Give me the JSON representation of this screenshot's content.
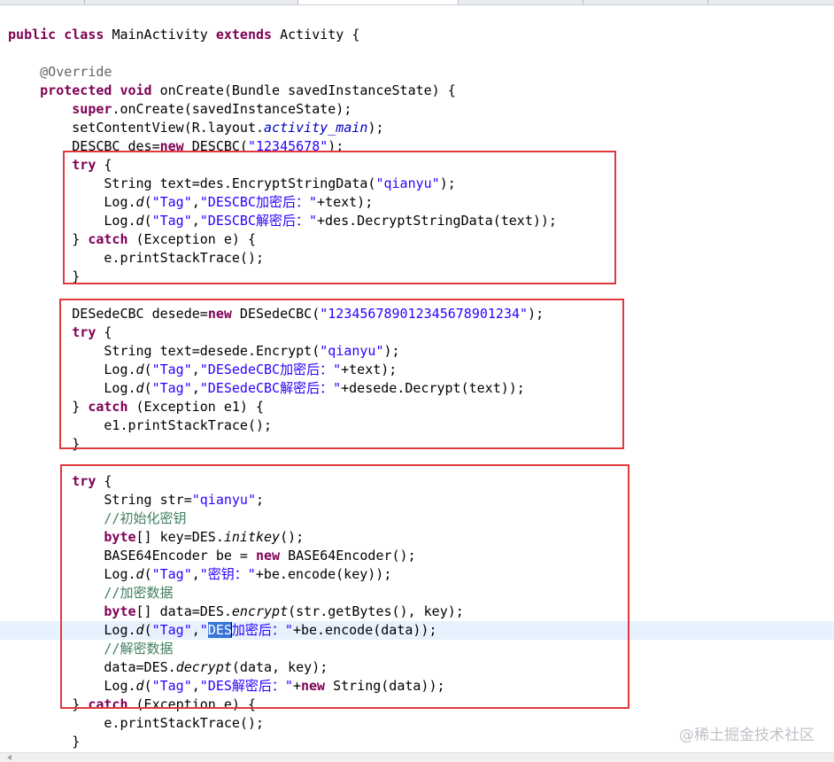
{
  "watermark": "@稀土掘金技术社区",
  "code": {
    "class_decl": {
      "kw1": "public",
      "kw2": "class",
      "name": "MainActivity",
      "kw3": "extends",
      "base": "Activity {"
    },
    "override": "@Override",
    "oncreate": {
      "kw1": "protected",
      "kw2": "void",
      "sig": "onCreate(Bundle savedInstanceState) {"
    },
    "super_call": {
      "kw": "super",
      "rest": ".onCreate(savedInstanceState);"
    },
    "set_content": {
      "pre": "setContentView(R.layout.",
      "field": "activity_main",
      "post": ");"
    },
    "descbc_decl": {
      "pre": "DESCBC des=",
      "kw": "new",
      "mid": " DESCBC(",
      "str": "\"12345678\"",
      "post": ");"
    },
    "block1": {
      "try": "try",
      "l1": {
        "pre": "String text=des.EncryptStringData(",
        "str": "\"qianyu\"",
        "post": ");"
      },
      "l2": {
        "pre": "Log.",
        "fn": "d",
        "p1": "(",
        "s1": "\"Tag\"",
        "c": ",",
        "s2": "\"DESCBC加密后：\"",
        "post": "+text);"
      },
      "l3": {
        "pre": "Log.",
        "fn": "d",
        "p1": "(",
        "s1": "\"Tag\"",
        "c": ",",
        "s2": "\"DESCBC解密后：\"",
        "post": "+des.DecryptStringData(text));"
      },
      "catch": {
        "pre": "} ",
        "kw": "catch",
        "post": " (Exception e) {"
      },
      "l4": "e.printStackTrace();",
      "close": "}"
    },
    "block2": {
      "decl": {
        "pre": "DESedeCBC desede=",
        "kw": "new",
        "mid": " DESedeCBC(",
        "str": "\"123456789012345678901234\"",
        "post": ");"
      },
      "try": "try",
      "l1": {
        "pre": "String text=desede.Encrypt(",
        "str": "\"qianyu\"",
        "post": ");"
      },
      "l2": {
        "pre": "Log.",
        "fn": "d",
        "p1": "(",
        "s1": "\"Tag\"",
        "c": ",",
        "s2": "\"DESedeCBC加密后：\"",
        "post": "+text);"
      },
      "l3": {
        "pre": "Log.",
        "fn": "d",
        "p1": "(",
        "s1": "\"Tag\"",
        "c": ",",
        "s2": "\"DESedeCBC解密后：\"",
        "post": "+desede.Decrypt(text));"
      },
      "catch": {
        "pre": "} ",
        "kw": "catch",
        "post": " (Exception e1) {"
      },
      "l4": "e1.printStackTrace();",
      "close": "}"
    },
    "block3": {
      "try": "try",
      "l1": {
        "pre": "String str=",
        "str": "\"qianyu\"",
        "post": ";"
      },
      "c1": "//初始化密钥",
      "l2": {
        "kw": "byte",
        "pre": "[] key=DES.",
        "fn": "initkey",
        "post": "();"
      },
      "l3": {
        "pre": "BASE64Encoder be = ",
        "kw": "new",
        "post": " BASE64Encoder();"
      },
      "l4": {
        "pre": "Log.",
        "fn": "d",
        "p1": "(",
        "s1": "\"Tag\"",
        "c": ",",
        "s2": "\"密钥：\"",
        "post": "+be.encode(key));"
      },
      "c2": "//加密数据",
      "l5": {
        "kw": "byte",
        "pre": "[] data=DES.",
        "fn": "encrypt",
        "post": "(str.getBytes(), key);"
      },
      "l6": {
        "pre": "Log.",
        "fn": "d",
        "p1": "(",
        "s1": "\"Tag\"",
        "c": ",",
        "q": "\"",
        "selected": "DES",
        "s2rest": "加密后：\"",
        "post": "+be.encode(data));"
      },
      "c3": "//解密数据",
      "l7": {
        "pre": "data=DES.",
        "fn": "decrypt",
        "post": "(data, key);"
      },
      "l8": {
        "pre": "Log.",
        "fn": "d",
        "p1": "(",
        "s1": "\"Tag\"",
        "c": ",",
        "s2": "\"DES解密后：\"",
        "post2a": "+",
        "kw": "new",
        "post2b": " String(data));"
      },
      "catch": {
        "pre": "} ",
        "kw": "catch",
        "post": " (Exception e) {"
      },
      "l9": "e.printStackTrace();",
      "close": "}"
    }
  }
}
